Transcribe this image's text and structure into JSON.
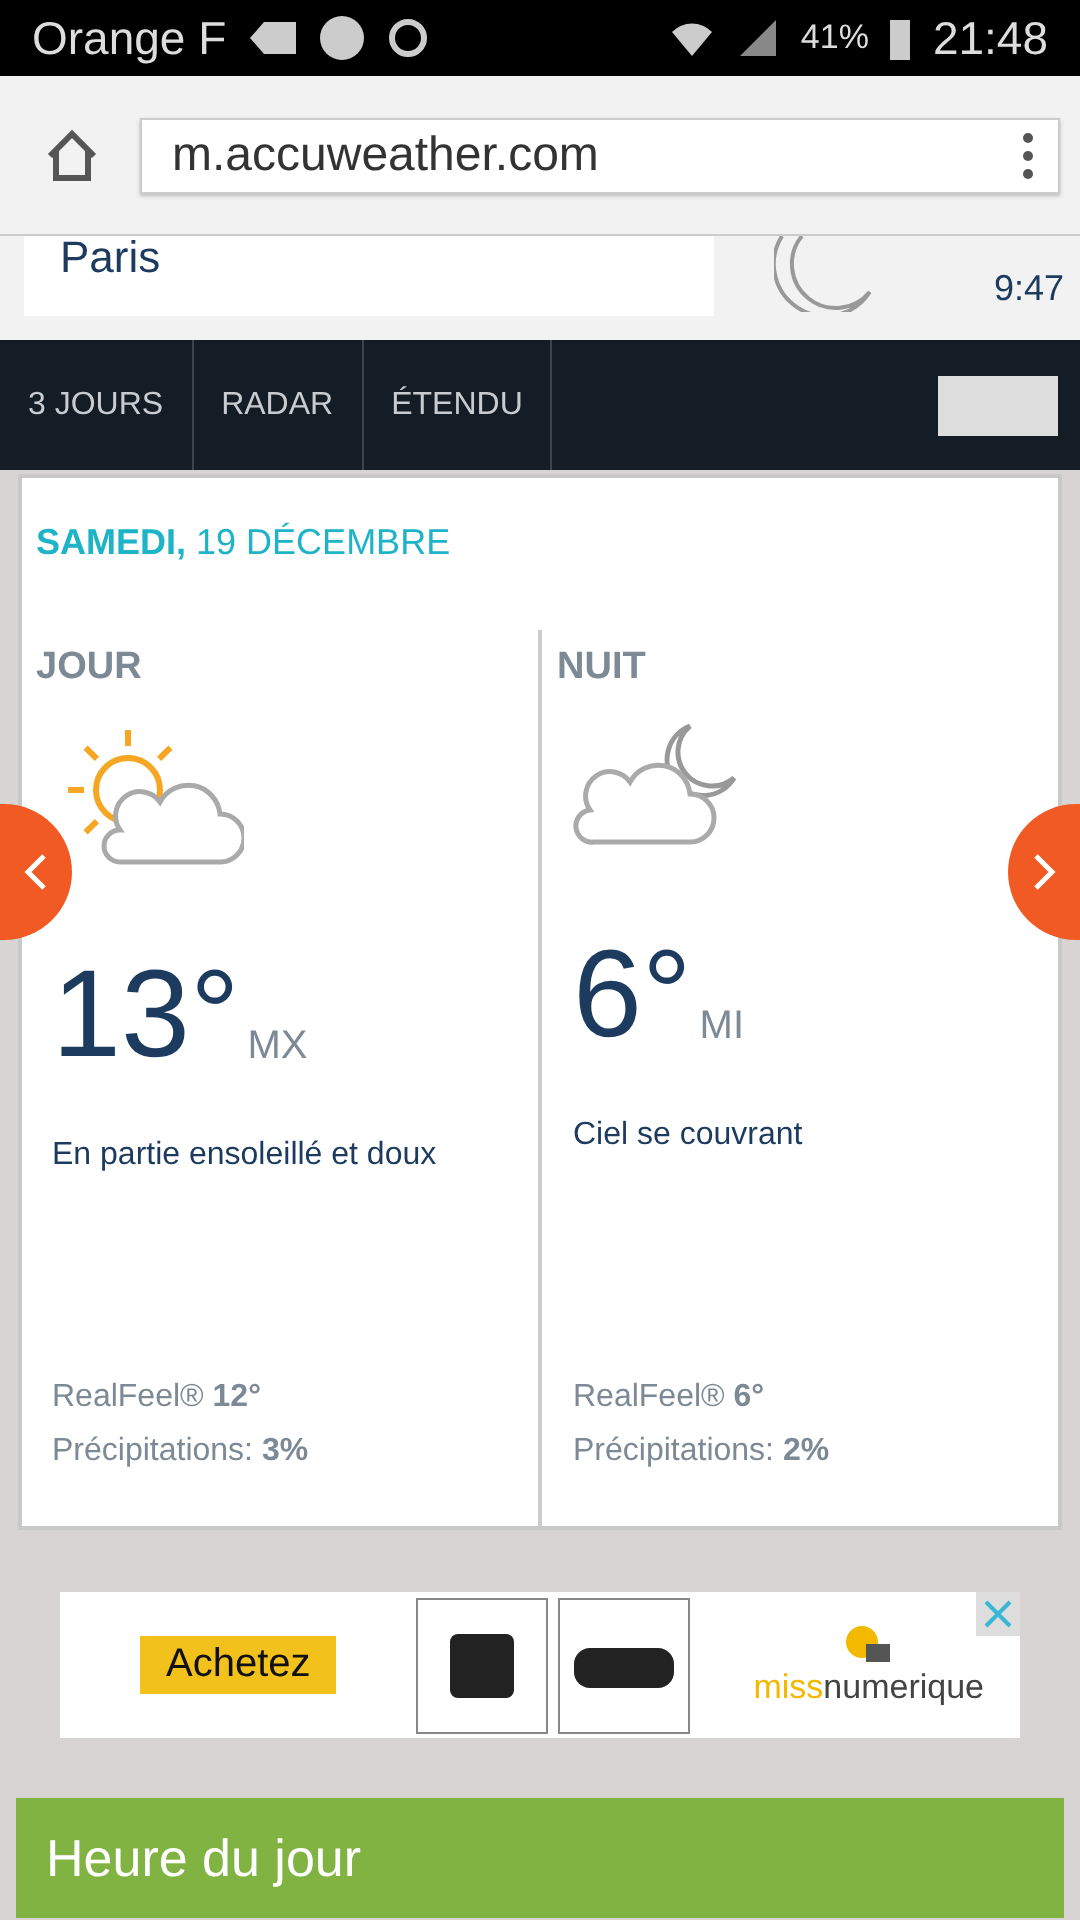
{
  "status_bar": {
    "carrier": "Orange F",
    "battery": "41%",
    "time": "21:48"
  },
  "browser": {
    "url": "m.accuweather.com"
  },
  "location": {
    "city": "Paris",
    "time": "9:47"
  },
  "nav_tabs": [
    "3 JOURS",
    "RADAR",
    "ÉTENDU"
  ],
  "forecast": {
    "day_name": "SAMEDI,",
    "date": "19 DÉCEMBRE",
    "periods": [
      {
        "kind": "day",
        "title": "JOUR",
        "temp": "13°",
        "temp_label": "MX",
        "phrase": "En partie ensoleillé et doux",
        "realfeel": "RealFeel® **12°**",
        "precip": "Précipitations: **3%**"
      },
      {
        "kind": "night",
        "title": "NUIT",
        "temp": "6°",
        "temp_label": "MI",
        "phrase": "Ciel se couvrant",
        "realfeel": "RealFeel® **6°**",
        "precip": "Précipitations: **2%**"
      }
    ]
  },
  "ad": {
    "button": "Achetez",
    "brand_part_1": "miss",
    "brand_part_2": "numerique"
  },
  "section": {
    "title": "Heure du jour"
  }
}
